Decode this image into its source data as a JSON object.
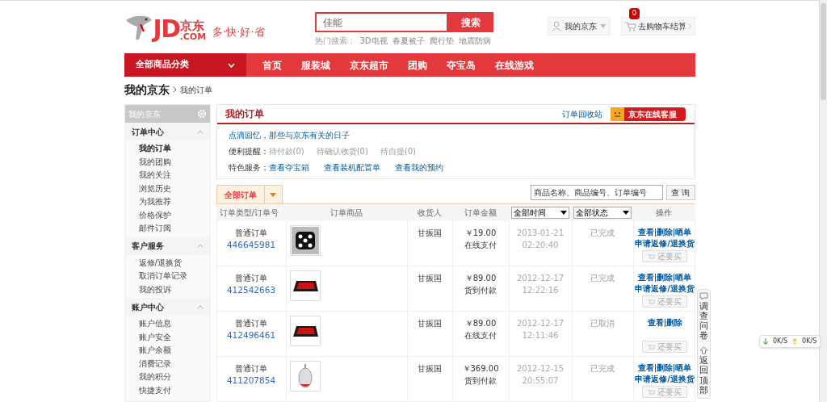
{
  "logo": {
    "mark": "JD",
    "name": "京东",
    "domain": ".COM",
    "slogan": "多·快·好·省"
  },
  "search": {
    "placeholder": "佳能",
    "button": "搜索",
    "hot_label": "热门搜索：",
    "hot": [
      "3D电视",
      "春夏被子",
      "爬行垫",
      "地震防病"
    ]
  },
  "account": {
    "label": "我的京东"
  },
  "cart": {
    "label": "去购物车结算",
    "count": "0"
  },
  "nav": {
    "category": "全部商品分类",
    "items": [
      "首页",
      "服装城",
      "京东超市",
      "团购",
      "夺宝岛",
      "在线游戏"
    ]
  },
  "breadcrumb": {
    "root": "我的京东",
    "current": "我的订单"
  },
  "sidebar": {
    "title": "我的京东",
    "sections": [
      {
        "title": "订单中心",
        "expanded": true,
        "items": [
          {
            "label": "我的订单",
            "selected": true
          },
          {
            "label": "我的团购",
            "selected": false
          },
          {
            "label": "我的关注",
            "selected": false
          },
          {
            "label": "浏览历史",
            "selected": false
          },
          {
            "label": "为我推荐",
            "selected": false
          },
          {
            "label": "价格保护",
            "selected": false
          },
          {
            "label": "邮件订阅",
            "selected": false
          }
        ]
      },
      {
        "title": "客户服务",
        "expanded": true,
        "items": [
          {
            "label": "返修/退换货",
            "selected": false
          },
          {
            "label": "取消订单记录",
            "selected": false
          },
          {
            "label": "我的投诉",
            "selected": false
          }
        ]
      },
      {
        "title": "账户中心",
        "expanded": true,
        "items": [
          {
            "label": "账户信息",
            "selected": false
          },
          {
            "label": "账户安全",
            "selected": false
          },
          {
            "label": "账户余额",
            "selected": false
          },
          {
            "label": "消费记录",
            "selected": false
          },
          {
            "label": "我的积分",
            "selected": false
          },
          {
            "label": "快捷支付",
            "selected": false
          }
        ]
      }
    ]
  },
  "panel": {
    "title": "我的订单",
    "recycle": "订单回收站",
    "service": "京东在线客服",
    "memory": "点滴回忆，那些与京东有关的日子",
    "reminder_label": "便利提醒：",
    "reminders": [
      "待付款(0)",
      "待确认收货(0)",
      "待自提(0)"
    ],
    "special_label": "特色服务：",
    "specials": [
      "查看夺宝箱",
      "查看装机配置单",
      "查看我的预约"
    ]
  },
  "tabs": [
    {
      "label": "全部订单",
      "selected": true
    }
  ],
  "order_search": {
    "placeholder": "商品名称、商品编号、订单编号",
    "button": "查 询"
  },
  "table": {
    "columns": [
      "订单类型/订单号",
      "订单商品",
      "收货人",
      "订单金额",
      {
        "dropdown": "全部时间"
      },
      {
        "dropdown": "全部状态"
      },
      "操作"
    ],
    "rows": [
      {
        "type": "普通订单",
        "number": "446645981",
        "product": {
          "kind": "dice"
        },
        "receiver": "甘振国",
        "amount": "￥19.00",
        "payment": "在线支付",
        "date": "2013-01-21",
        "time": "02:20:40",
        "status": "已完成",
        "links": [
          "查看",
          "删除",
          "晒单"
        ],
        "repair": "申请返修/退换货",
        "rebuy": "还要买"
      },
      {
        "type": "普通订单",
        "number": "412542663",
        "product": {
          "kind": "mousepad"
        },
        "receiver": "甘振国",
        "amount": "￥89.00",
        "payment": "货到付款",
        "date": "2012-12-17",
        "time": "12:22:16",
        "status": "已完成",
        "links": [
          "查看",
          "删除",
          "晒单"
        ],
        "repair": "申请返修/退换货",
        "rebuy": "还要买"
      },
      {
        "type": "普通订单",
        "number": "412496461",
        "product": {
          "kind": "mousepad"
        },
        "receiver": "甘振国",
        "amount": "￥89.00",
        "payment": "在线支付",
        "date": "2012-12-17",
        "time": "12:11:46",
        "status": "已取消",
        "links": [
          "查看",
          "删除"
        ],
        "rebuy": "还要买"
      },
      {
        "type": "普通订单",
        "number": "411207854",
        "product": {
          "kind": "mouse"
        },
        "receiver": "甘振国",
        "amount": "￥369.00",
        "payment": "货到付款",
        "date": "2012-12-15",
        "time": "20:55:07",
        "status": "已完成",
        "links": [
          "查看",
          "删除",
          "晒单"
        ],
        "repair": "申请返修/退换货",
        "rebuy": "还要买"
      }
    ]
  },
  "float": {
    "survey": "调查问卷",
    "top": "返回顶部"
  },
  "speed": {
    "down": "0K/S",
    "up": "0K/S"
  }
}
